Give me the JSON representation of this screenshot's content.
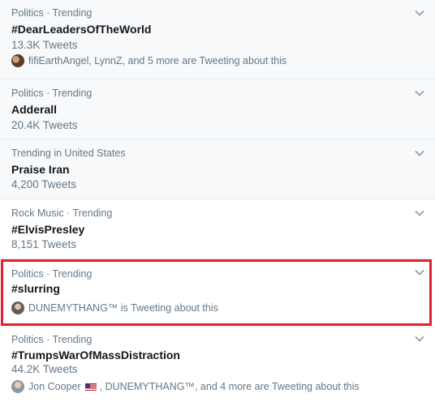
{
  "trends": [
    {
      "meta": "Politics · Trending",
      "name": "#DearLeadersOfTheWorld",
      "count": "13.3K Tweets",
      "context": "fifiEarthAngel, LynnZ, and 5 more are Tweeting about this"
    },
    {
      "meta": "Politics · Trending",
      "name": "Adderall",
      "count": "20.4K Tweets"
    },
    {
      "meta": "Trending in United States",
      "name": "Praise Iran",
      "count": "4,200 Tweets"
    },
    {
      "meta": "Rock Music · Trending",
      "name": "#ElvisPresley",
      "count": "8,151 Tweets"
    },
    {
      "meta": "Politics · Trending",
      "name": "#slurring",
      "context": "DUNEMYTHANG™ is Tweeting about this"
    },
    {
      "meta": "Politics · Trending",
      "name": "#TrumpsWarOfMassDistraction",
      "count": "44.2K Tweets",
      "context_user1": "Jon Cooper",
      "context_rest": ", DUNEMYTHANG™, and 4 more are Tweeting about this"
    }
  ],
  "icons": {
    "chevron": "chevron-down-icon",
    "avatar": "avatar",
    "flag": "us-flag-icon"
  },
  "colors": {
    "meta_text": "#657786",
    "highlight_border": "#e0202e",
    "shaded_row": "#f7f9fa"
  }
}
